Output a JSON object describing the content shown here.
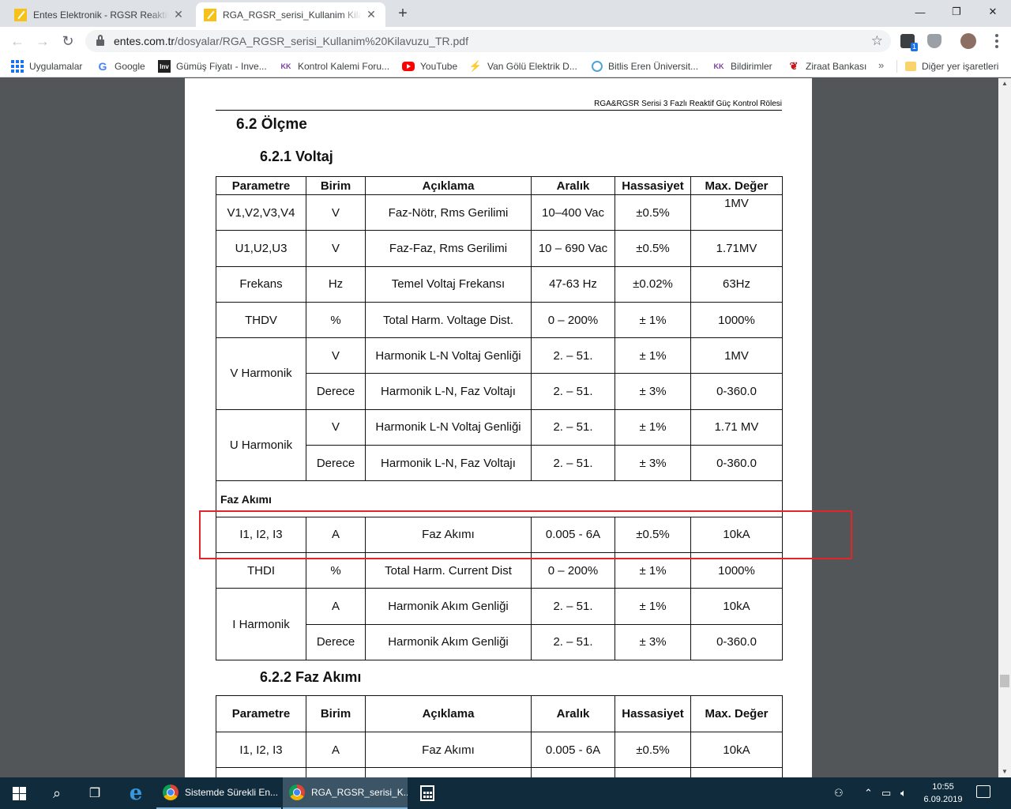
{
  "browser": {
    "tabs": [
      {
        "title": "Entes Elektronik - RGSR Reaktif G",
        "active": false
      },
      {
        "title": "RGA_RGSR_serisi_Kullanim Kilavu",
        "active": true
      }
    ],
    "new_tab": "+",
    "window_controls": {
      "minimize": "—",
      "maximize": "❐",
      "close": "✕"
    },
    "url_host": "entes.com.tr",
    "url_path": "/dosyalar/RGA_RGSR_serisi_Kullanim%20Kilavuzu_TR.pdf",
    "star": "☆",
    "extension_badge": "1",
    "bookmarks": [
      {
        "label": "Uygulamalar",
        "icon": "apps-grid-icon"
      },
      {
        "label": "Google",
        "icon": "google-icon",
        "glyph": "G"
      },
      {
        "label": "Gümüş Fiyatı - Inve...",
        "icon": "investing-icon",
        "glyph": "Inv"
      },
      {
        "label": "Kontrol Kalemi Foru...",
        "icon": "kk-icon",
        "glyph": "KK"
      },
      {
        "label": "YouTube",
        "icon": "youtube-icon"
      },
      {
        "label": "Van Gölü Elektrik D...",
        "icon": "bolt-icon",
        "glyph": "⚡"
      },
      {
        "label": "Bitlis Eren Üniversit...",
        "icon": "university-icon"
      },
      {
        "label": "Bildirimler",
        "icon": "kk-icon",
        "glyph": "KK"
      },
      {
        "label": "Ziraat Bankası",
        "icon": "ziraat-icon",
        "glyph": "❦"
      }
    ],
    "bookmarks_more": "»",
    "other_bookmarks": "Diğer yer işaretleri"
  },
  "pdf": {
    "header": "RGA&RGSR Serisi 3 Fazlı Reaktif Güç Kontrol Rölesi",
    "section_title": "6.2 Ölçme",
    "subsection_voltage": "6.2.1 Voltaj",
    "subsection_current": "6.2.2 Faz Akımı",
    "columns": [
      "Parametre",
      "Birim",
      "Açıklama",
      "Aralık",
      "Hassasiyet",
      "Max. Değer"
    ],
    "voltage_rows": [
      [
        "V1,V2,V3,V4",
        "V",
        "Faz-Nötr, Rms Gerilimi",
        "10–400 Vac",
        "±0.5%",
        "1MV"
      ],
      [
        "U1,U2,U3",
        "V",
        "Faz-Faz, Rms Gerilimi",
        "10 – 690 Vac",
        "±0.5%",
        "1.71MV"
      ],
      [
        "Frekans",
        "Hz",
        "Temel Voltaj Frekansı",
        "47-63 Hz",
        "±0.02%",
        "63Hz"
      ],
      [
        "THDV",
        "%",
        "Total Harm. Voltage Dist.",
        "0 – 200%",
        "± 1%",
        "1000%"
      ]
    ],
    "v_harmonic": {
      "name": "V Harmonik",
      "rows": [
        [
          "V",
          "Harmonik L-N Voltaj Genliği",
          "2. – 51.",
          "± 1%",
          "1MV"
        ],
        [
          "Derece",
          "Harmonik L-N, Faz Voltajı",
          "2. – 51.",
          "± 3%",
          "0-360.0"
        ]
      ]
    },
    "u_harmonic": {
      "name": "U Harmonik",
      "rows": [
        [
          "V",
          "Harmonik L-N Voltaj Genliği",
          "2. – 51.",
          "± 1%",
          "1.71 MV"
        ],
        [
          "Derece",
          "Harmonik L-N, Faz Voltajı",
          "2. – 51.",
          "± 3%",
          "0-360.0"
        ]
      ]
    },
    "phase_current_label": "Faz Akımı",
    "current_rows": [
      [
        "I1, I2, I3",
        "A",
        "Faz Akımı",
        "0.005 - 6A",
        "±0.5%",
        "10kA"
      ],
      [
        "THDI",
        "%",
        "Total Harm. Current Dist",
        "0 – 200%",
        "± 1%",
        "1000%"
      ]
    ],
    "i_harmonic": {
      "name": "I Harmonik",
      "rows": [
        [
          "A",
          "Harmonik Akım Genliği",
          "2. – 51.",
          "± 1%",
          "10kA"
        ],
        [
          "Derece",
          "Harmonik Akım Genliği",
          "2. – 51.",
          "± 3%",
          "0-360.0"
        ]
      ]
    },
    "table2_rows": [
      [
        "I1, I2, I3",
        "A",
        "Faz Akımı",
        "0.005 - 6A",
        "±0.5%",
        "10kA"
      ]
    ]
  },
  "taskbar": {
    "apps": [
      {
        "label": "Sistemde Sürekli En...",
        "icon": "chrome-icon"
      },
      {
        "label": "RGA_RGSR_serisi_K...",
        "icon": "chrome-icon"
      }
    ],
    "time": "10:55",
    "date": "6.09.2019"
  },
  "colors": {
    "highlight_frame": "#e0262b",
    "taskbar": "#0f2b3c",
    "viewer_bg": "#525659"
  }
}
